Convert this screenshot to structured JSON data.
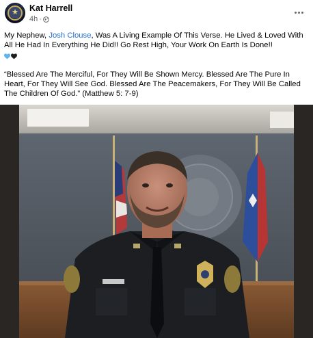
{
  "post": {
    "author": "Kat Harrell",
    "time": "4h",
    "separator": "·",
    "audience_icon": "globe-icon",
    "more_icon": "more-options-icon",
    "text": {
      "p1_before": "My Nephew, ",
      "mention": "Josh Clouse",
      "p1_after": ", Was A Living Example Of This Verse.  He Lived & Loved With All He Had In Everything He Did!!  Go Rest High, Your Work On Earth Is Done!!",
      "hearts": [
        "blue-heart-icon",
        "black-heart-icon"
      ],
      "p2": "“Blessed Are The Merciful, For They Will Be Shown Mercy.  Blessed Are The Pure In Heart, For They Will See God.  Blessed Are The Peacemakers, For They Will Be Called The Children Of God.”  (Matthew 5: 7-9)"
    },
    "colors": {
      "link": "#216fdb",
      "secondary_text": "#65676b",
      "blue_heart": "#5bb5ef",
      "black_heart": "#1c1e21"
    },
    "photo": {
      "description_icon": "officer-portrait-photo"
    }
  }
}
